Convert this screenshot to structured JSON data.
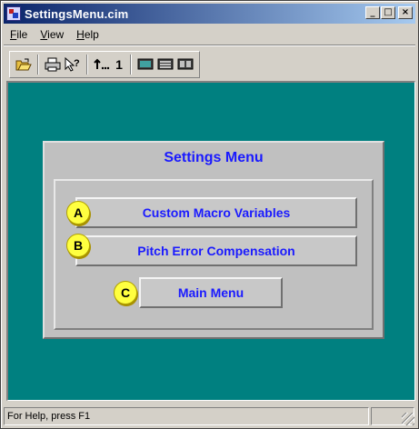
{
  "window": {
    "title": "SettingsMenu.cim"
  },
  "caption_buttons": {
    "minimize": "_",
    "maximize": "□",
    "close": "×"
  },
  "menubar": {
    "items": [
      {
        "key": "F",
        "rest": "ile"
      },
      {
        "key": "V",
        "rest": "iew"
      },
      {
        "key": "H",
        "rest": "elp"
      }
    ]
  },
  "toolbar": {
    "icons": [
      "open-folder-icon",
      "print-icon",
      "context-help-icon",
      "step-back-icon",
      "monitor-icon",
      "list-view-icon",
      "split-view-icon"
    ],
    "counter": "1"
  },
  "screen": {
    "title": "Settings Menu",
    "buttons": [
      {
        "badge": "A",
        "label": "Custom Macro Variables"
      },
      {
        "badge": "B",
        "label": "Pitch Error Compensation"
      },
      {
        "badge": "C",
        "label": "Main Menu"
      }
    ]
  },
  "statusbar": {
    "text": "For Help, press F1"
  },
  "colors": {
    "background": "#008080",
    "title_bar": "#0a246a",
    "label_text": "#1a1aff",
    "badge": "#ffff40"
  }
}
